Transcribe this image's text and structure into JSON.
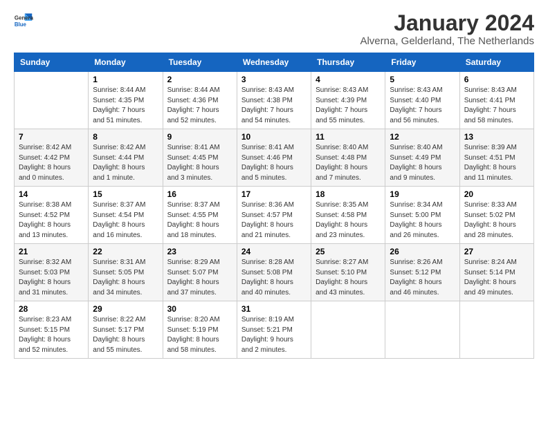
{
  "logo": {
    "line1": "General",
    "line2": "Blue"
  },
  "title": "January 2024",
  "subtitle": "Alverna, Gelderland, The Netherlands",
  "days_header": [
    "Sunday",
    "Monday",
    "Tuesday",
    "Wednesday",
    "Thursday",
    "Friday",
    "Saturday"
  ],
  "weeks": [
    [
      {
        "num": "",
        "detail": ""
      },
      {
        "num": "1",
        "detail": "Sunrise: 8:44 AM\nSunset: 4:35 PM\nDaylight: 7 hours\nand 51 minutes."
      },
      {
        "num": "2",
        "detail": "Sunrise: 8:44 AM\nSunset: 4:36 PM\nDaylight: 7 hours\nand 52 minutes."
      },
      {
        "num": "3",
        "detail": "Sunrise: 8:43 AM\nSunset: 4:38 PM\nDaylight: 7 hours\nand 54 minutes."
      },
      {
        "num": "4",
        "detail": "Sunrise: 8:43 AM\nSunset: 4:39 PM\nDaylight: 7 hours\nand 55 minutes."
      },
      {
        "num": "5",
        "detail": "Sunrise: 8:43 AM\nSunset: 4:40 PM\nDaylight: 7 hours\nand 56 minutes."
      },
      {
        "num": "6",
        "detail": "Sunrise: 8:43 AM\nSunset: 4:41 PM\nDaylight: 7 hours\nand 58 minutes."
      }
    ],
    [
      {
        "num": "7",
        "detail": "Sunrise: 8:42 AM\nSunset: 4:42 PM\nDaylight: 8 hours\nand 0 minutes."
      },
      {
        "num": "8",
        "detail": "Sunrise: 8:42 AM\nSunset: 4:44 PM\nDaylight: 8 hours\nand 1 minute."
      },
      {
        "num": "9",
        "detail": "Sunrise: 8:41 AM\nSunset: 4:45 PM\nDaylight: 8 hours\nand 3 minutes."
      },
      {
        "num": "10",
        "detail": "Sunrise: 8:41 AM\nSunset: 4:46 PM\nDaylight: 8 hours\nand 5 minutes."
      },
      {
        "num": "11",
        "detail": "Sunrise: 8:40 AM\nSunset: 4:48 PM\nDaylight: 8 hours\nand 7 minutes."
      },
      {
        "num": "12",
        "detail": "Sunrise: 8:40 AM\nSunset: 4:49 PM\nDaylight: 8 hours\nand 9 minutes."
      },
      {
        "num": "13",
        "detail": "Sunrise: 8:39 AM\nSunset: 4:51 PM\nDaylight: 8 hours\nand 11 minutes."
      }
    ],
    [
      {
        "num": "14",
        "detail": "Sunrise: 8:38 AM\nSunset: 4:52 PM\nDaylight: 8 hours\nand 13 minutes."
      },
      {
        "num": "15",
        "detail": "Sunrise: 8:37 AM\nSunset: 4:54 PM\nDaylight: 8 hours\nand 16 minutes."
      },
      {
        "num": "16",
        "detail": "Sunrise: 8:37 AM\nSunset: 4:55 PM\nDaylight: 8 hours\nand 18 minutes."
      },
      {
        "num": "17",
        "detail": "Sunrise: 8:36 AM\nSunset: 4:57 PM\nDaylight: 8 hours\nand 21 minutes."
      },
      {
        "num": "18",
        "detail": "Sunrise: 8:35 AM\nSunset: 4:58 PM\nDaylight: 8 hours\nand 23 minutes."
      },
      {
        "num": "19",
        "detail": "Sunrise: 8:34 AM\nSunset: 5:00 PM\nDaylight: 8 hours\nand 26 minutes."
      },
      {
        "num": "20",
        "detail": "Sunrise: 8:33 AM\nSunset: 5:02 PM\nDaylight: 8 hours\nand 28 minutes."
      }
    ],
    [
      {
        "num": "21",
        "detail": "Sunrise: 8:32 AM\nSunset: 5:03 PM\nDaylight: 8 hours\nand 31 minutes."
      },
      {
        "num": "22",
        "detail": "Sunrise: 8:31 AM\nSunset: 5:05 PM\nDaylight: 8 hours\nand 34 minutes."
      },
      {
        "num": "23",
        "detail": "Sunrise: 8:29 AM\nSunset: 5:07 PM\nDaylight: 8 hours\nand 37 minutes."
      },
      {
        "num": "24",
        "detail": "Sunrise: 8:28 AM\nSunset: 5:08 PM\nDaylight: 8 hours\nand 40 minutes."
      },
      {
        "num": "25",
        "detail": "Sunrise: 8:27 AM\nSunset: 5:10 PM\nDaylight: 8 hours\nand 43 minutes."
      },
      {
        "num": "26",
        "detail": "Sunrise: 8:26 AM\nSunset: 5:12 PM\nDaylight: 8 hours\nand 46 minutes."
      },
      {
        "num": "27",
        "detail": "Sunrise: 8:24 AM\nSunset: 5:14 PM\nDaylight: 8 hours\nand 49 minutes."
      }
    ],
    [
      {
        "num": "28",
        "detail": "Sunrise: 8:23 AM\nSunset: 5:15 PM\nDaylight: 8 hours\nand 52 minutes."
      },
      {
        "num": "29",
        "detail": "Sunrise: 8:22 AM\nSunset: 5:17 PM\nDaylight: 8 hours\nand 55 minutes."
      },
      {
        "num": "30",
        "detail": "Sunrise: 8:20 AM\nSunset: 5:19 PM\nDaylight: 8 hours\nand 58 minutes."
      },
      {
        "num": "31",
        "detail": "Sunrise: 8:19 AM\nSunset: 5:21 PM\nDaylight: 9 hours\nand 2 minutes."
      },
      {
        "num": "",
        "detail": ""
      },
      {
        "num": "",
        "detail": ""
      },
      {
        "num": "",
        "detail": ""
      }
    ]
  ]
}
